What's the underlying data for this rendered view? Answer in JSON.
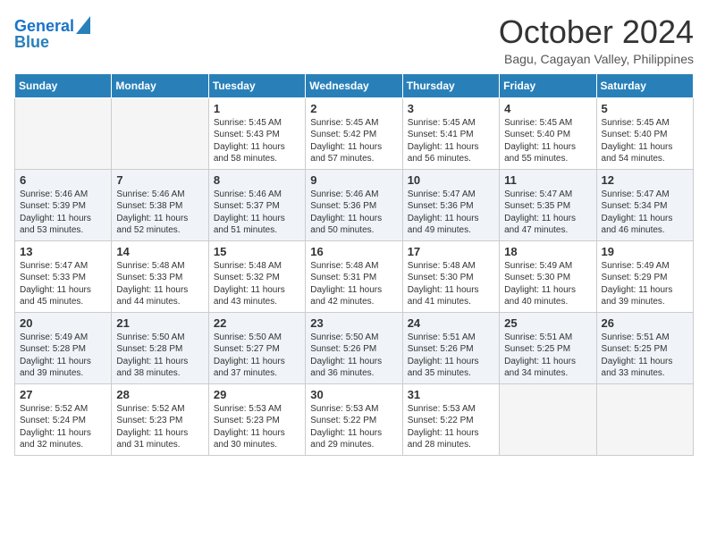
{
  "logo": {
    "line1": "General",
    "line2": "Blue"
  },
  "title": "October 2024",
  "subtitle": "Bagu, Cagayan Valley, Philippines",
  "weekdays": [
    "Sunday",
    "Monday",
    "Tuesday",
    "Wednesday",
    "Thursday",
    "Friday",
    "Saturday"
  ],
  "weeks": [
    [
      {
        "day": "",
        "sunrise": "",
        "sunset": "",
        "daylight": ""
      },
      {
        "day": "",
        "sunrise": "",
        "sunset": "",
        "daylight": ""
      },
      {
        "day": "1",
        "sunrise": "Sunrise: 5:45 AM",
        "sunset": "Sunset: 5:43 PM",
        "daylight": "Daylight: 11 hours and 58 minutes."
      },
      {
        "day": "2",
        "sunrise": "Sunrise: 5:45 AM",
        "sunset": "Sunset: 5:42 PM",
        "daylight": "Daylight: 11 hours and 57 minutes."
      },
      {
        "day": "3",
        "sunrise": "Sunrise: 5:45 AM",
        "sunset": "Sunset: 5:41 PM",
        "daylight": "Daylight: 11 hours and 56 minutes."
      },
      {
        "day": "4",
        "sunrise": "Sunrise: 5:45 AM",
        "sunset": "Sunset: 5:40 PM",
        "daylight": "Daylight: 11 hours and 55 minutes."
      },
      {
        "day": "5",
        "sunrise": "Sunrise: 5:45 AM",
        "sunset": "Sunset: 5:40 PM",
        "daylight": "Daylight: 11 hours and 54 minutes."
      }
    ],
    [
      {
        "day": "6",
        "sunrise": "Sunrise: 5:46 AM",
        "sunset": "Sunset: 5:39 PM",
        "daylight": "Daylight: 11 hours and 53 minutes."
      },
      {
        "day": "7",
        "sunrise": "Sunrise: 5:46 AM",
        "sunset": "Sunset: 5:38 PM",
        "daylight": "Daylight: 11 hours and 52 minutes."
      },
      {
        "day": "8",
        "sunrise": "Sunrise: 5:46 AM",
        "sunset": "Sunset: 5:37 PM",
        "daylight": "Daylight: 11 hours and 51 minutes."
      },
      {
        "day": "9",
        "sunrise": "Sunrise: 5:46 AM",
        "sunset": "Sunset: 5:36 PM",
        "daylight": "Daylight: 11 hours and 50 minutes."
      },
      {
        "day": "10",
        "sunrise": "Sunrise: 5:47 AM",
        "sunset": "Sunset: 5:36 PM",
        "daylight": "Daylight: 11 hours and 49 minutes."
      },
      {
        "day": "11",
        "sunrise": "Sunrise: 5:47 AM",
        "sunset": "Sunset: 5:35 PM",
        "daylight": "Daylight: 11 hours and 47 minutes."
      },
      {
        "day": "12",
        "sunrise": "Sunrise: 5:47 AM",
        "sunset": "Sunset: 5:34 PM",
        "daylight": "Daylight: 11 hours and 46 minutes."
      }
    ],
    [
      {
        "day": "13",
        "sunrise": "Sunrise: 5:47 AM",
        "sunset": "Sunset: 5:33 PM",
        "daylight": "Daylight: 11 hours and 45 minutes."
      },
      {
        "day": "14",
        "sunrise": "Sunrise: 5:48 AM",
        "sunset": "Sunset: 5:33 PM",
        "daylight": "Daylight: 11 hours and 44 minutes."
      },
      {
        "day": "15",
        "sunrise": "Sunrise: 5:48 AM",
        "sunset": "Sunset: 5:32 PM",
        "daylight": "Daylight: 11 hours and 43 minutes."
      },
      {
        "day": "16",
        "sunrise": "Sunrise: 5:48 AM",
        "sunset": "Sunset: 5:31 PM",
        "daylight": "Daylight: 11 hours and 42 minutes."
      },
      {
        "day": "17",
        "sunrise": "Sunrise: 5:48 AM",
        "sunset": "Sunset: 5:30 PM",
        "daylight": "Daylight: 11 hours and 41 minutes."
      },
      {
        "day": "18",
        "sunrise": "Sunrise: 5:49 AM",
        "sunset": "Sunset: 5:30 PM",
        "daylight": "Daylight: 11 hours and 40 minutes."
      },
      {
        "day": "19",
        "sunrise": "Sunrise: 5:49 AM",
        "sunset": "Sunset: 5:29 PM",
        "daylight": "Daylight: 11 hours and 39 minutes."
      }
    ],
    [
      {
        "day": "20",
        "sunrise": "Sunrise: 5:49 AM",
        "sunset": "Sunset: 5:28 PM",
        "daylight": "Daylight: 11 hours and 39 minutes."
      },
      {
        "day": "21",
        "sunrise": "Sunrise: 5:50 AM",
        "sunset": "Sunset: 5:28 PM",
        "daylight": "Daylight: 11 hours and 38 minutes."
      },
      {
        "day": "22",
        "sunrise": "Sunrise: 5:50 AM",
        "sunset": "Sunset: 5:27 PM",
        "daylight": "Daylight: 11 hours and 37 minutes."
      },
      {
        "day": "23",
        "sunrise": "Sunrise: 5:50 AM",
        "sunset": "Sunset: 5:26 PM",
        "daylight": "Daylight: 11 hours and 36 minutes."
      },
      {
        "day": "24",
        "sunrise": "Sunrise: 5:51 AM",
        "sunset": "Sunset: 5:26 PM",
        "daylight": "Daylight: 11 hours and 35 minutes."
      },
      {
        "day": "25",
        "sunrise": "Sunrise: 5:51 AM",
        "sunset": "Sunset: 5:25 PM",
        "daylight": "Daylight: 11 hours and 34 minutes."
      },
      {
        "day": "26",
        "sunrise": "Sunrise: 5:51 AM",
        "sunset": "Sunset: 5:25 PM",
        "daylight": "Daylight: 11 hours and 33 minutes."
      }
    ],
    [
      {
        "day": "27",
        "sunrise": "Sunrise: 5:52 AM",
        "sunset": "Sunset: 5:24 PM",
        "daylight": "Daylight: 11 hours and 32 minutes."
      },
      {
        "day": "28",
        "sunrise": "Sunrise: 5:52 AM",
        "sunset": "Sunset: 5:23 PM",
        "daylight": "Daylight: 11 hours and 31 minutes."
      },
      {
        "day": "29",
        "sunrise": "Sunrise: 5:53 AM",
        "sunset": "Sunset: 5:23 PM",
        "daylight": "Daylight: 11 hours and 30 minutes."
      },
      {
        "day": "30",
        "sunrise": "Sunrise: 5:53 AM",
        "sunset": "Sunset: 5:22 PM",
        "daylight": "Daylight: 11 hours and 29 minutes."
      },
      {
        "day": "31",
        "sunrise": "Sunrise: 5:53 AM",
        "sunset": "Sunset: 5:22 PM",
        "daylight": "Daylight: 11 hours and 28 minutes."
      },
      {
        "day": "",
        "sunrise": "",
        "sunset": "",
        "daylight": ""
      },
      {
        "day": "",
        "sunrise": "",
        "sunset": "",
        "daylight": ""
      }
    ]
  ]
}
